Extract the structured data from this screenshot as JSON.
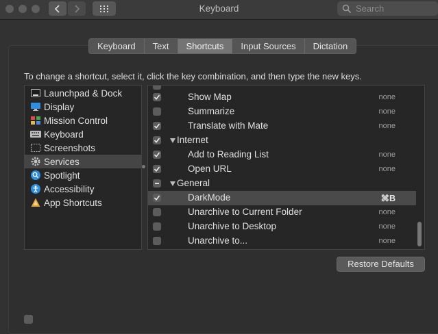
{
  "window": {
    "title": "Keyboard"
  },
  "search": {
    "placeholder": "Search"
  },
  "tabs": [
    {
      "label": "Keyboard"
    },
    {
      "label": "Text"
    },
    {
      "label": "Shortcuts",
      "active": true
    },
    {
      "label": "Input Sources"
    },
    {
      "label": "Dictation"
    }
  ],
  "instructions": "To change a shortcut, select it, click the key combination, and then type the new keys.",
  "categories": [
    {
      "label": "Launchpad & Dock",
      "icon": "launchpad-dock-icon"
    },
    {
      "label": "Display",
      "icon": "display-icon"
    },
    {
      "label": "Mission Control",
      "icon": "mission-control-icon"
    },
    {
      "label": "Keyboard",
      "icon": "keyboard-icon"
    },
    {
      "label": "Screenshots",
      "icon": "screenshots-icon"
    },
    {
      "label": "Services",
      "icon": "gear-icon",
      "selected": true
    },
    {
      "label": "Spotlight",
      "icon": "spotlight-icon"
    },
    {
      "label": "Accessibility",
      "icon": "accessibility-icon"
    },
    {
      "label": "App Shortcuts",
      "icon": "app-shortcuts-icon"
    }
  ],
  "shortcuts": [
    {
      "type": "item",
      "label": "Show Map",
      "checked": true,
      "key": "none"
    },
    {
      "type": "item",
      "label": "Summarize",
      "checked": false,
      "key": "none"
    },
    {
      "type": "item",
      "label": "Translate with Mate",
      "checked": true,
      "key": "none"
    },
    {
      "type": "group",
      "label": "Internet",
      "state": "checked"
    },
    {
      "type": "item",
      "label": "Add to Reading List",
      "checked": true,
      "key": "none"
    },
    {
      "type": "item",
      "label": "Open URL",
      "checked": true,
      "key": "none"
    },
    {
      "type": "group",
      "label": "General",
      "state": "mixed"
    },
    {
      "type": "item",
      "label": "DarkMode",
      "checked": true,
      "key": "⌘B",
      "selected": true
    },
    {
      "type": "item",
      "label": "Unarchive to Current Folder",
      "checked": false,
      "key": "none"
    },
    {
      "type": "item",
      "label": "Unarchive to Desktop",
      "checked": false,
      "key": "none"
    },
    {
      "type": "item",
      "label": "Unarchive to...",
      "checked": false,
      "key": "none"
    }
  ],
  "restore_label": "Restore Defaults",
  "colors": {
    "background": "#323232",
    "list_bg": "#262626",
    "selected_row": "#4a4a4a"
  }
}
